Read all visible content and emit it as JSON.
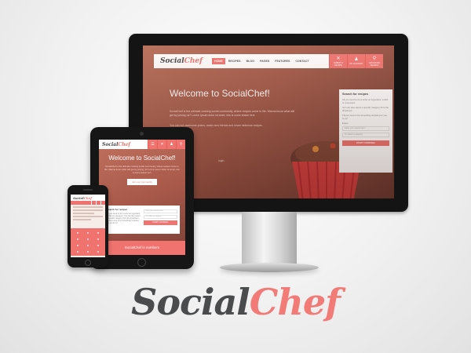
{
  "brand": {
    "part1": "Social",
    "part2": "Chef"
  },
  "desktop": {
    "logo": {
      "part1": "Social",
      "part2": "Chef"
    },
    "nav": [
      "HOME",
      "RECIPES",
      "BLOG",
      "PAGES",
      "FEATURES",
      "CONTACT"
    ],
    "nav_buttons": [
      {
        "icon": "close-icon",
        "glyph": "✕",
        "label": "SUBMIT A RECIPE"
      },
      {
        "icon": "user-icon",
        "glyph": "♟",
        "label": "MY ACCOUNT"
      },
      {
        "icon": "search-icon",
        "glyph": "⚲",
        "label": "ADVANCED SEARCH"
      }
    ],
    "hero_title": "Welcome to SocialChef!",
    "hero_text": "SocialChef is the ultimate cooking social community, where recipes come to life. Wanna know what will get by joining us? Lorem ipsum dolor sit amet, this is some teaser text.",
    "hero_text2": "You can win awesome prizes, make new friends and share delicious recipes.",
    "login_text": "login",
    "search": {
      "heading": "Search for recipes",
      "text1": "All you need to do is enter an ingredient, a dish or a keyword.",
      "text2": "You can also select a specific category from the dropdown.",
      "text3": "There's sure to be something tempting for you to try!",
      "label": "Enjoy!",
      "field1": "Enter your search term",
      "field2": "Or select a category",
      "button": "START COOKING!"
    }
  },
  "tablet": {
    "logo": {
      "part1": "Social",
      "part2": "Chef"
    },
    "hero_title": "Welcome to SocialChef!",
    "hero_text": "SocialChef is the ultimate cooking social community, where recipes come to life. Wanna know what will get by joining us? Lorem ipsum dolor sit amet, this is some teaser text.",
    "join_button": "Join our community",
    "search_heading": "Search for recipes",
    "search_text": "All you need to do is enter an ingredient, a dish or a keyword. You can also select a specific category from the dropdown. There's sure to be something tempting for you to try!",
    "field1": "Enter your search term",
    "field2": "Or select a category",
    "search_button": "START COOKING!",
    "numbers": "SocialChef in numbers"
  },
  "phone": {
    "logo": {
      "part1": "Social",
      "part2": "Chef"
    }
  },
  "colors": {
    "accent": "#f0736f",
    "dark": "#4a4b4d"
  }
}
